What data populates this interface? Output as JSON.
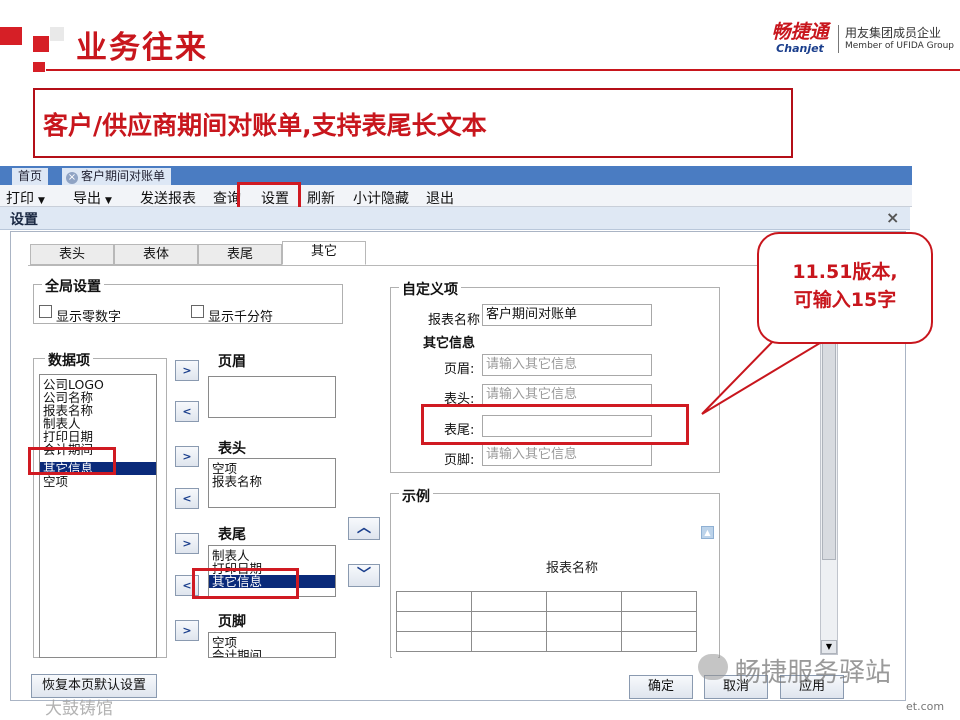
{
  "slide": {
    "title": "业务往来",
    "subtitle": "客户/供应商期间对账单,支持表尾长文本",
    "brand_name": "畅捷通",
    "brand_sub": "Chanjet",
    "brand_right1": "用友集团成员企业",
    "brand_right2": "Member of UFIDA Group",
    "accent_color": "#c8161d"
  },
  "app": {
    "tabs": [
      "首页",
      "客户期间对账单"
    ],
    "toolbar": [
      "打印",
      "导出",
      "发送报表",
      "查询",
      "设置",
      "刷新",
      "小计隐藏",
      "退出"
    ]
  },
  "dialog": {
    "title": "设置",
    "close": "×",
    "tabs": [
      "表头",
      "表体",
      "表尾",
      "其它"
    ],
    "global": {
      "legend": "全局设置",
      "show_zero": "显示零数字",
      "show_thousands": "显示千分符"
    },
    "data_items": {
      "legend": "数据项",
      "items": [
        "公司LOGO",
        "公司名称",
        "报表名称",
        "制表人",
        "打印日期",
        "会计期间",
        "其它信息",
        "空项"
      ],
      "selected": "其它信息"
    },
    "arrows": {
      "right": ">",
      "left": "<",
      "up": "︿",
      "down": "﹀"
    },
    "page_header": {
      "legend": "页眉",
      "items": []
    },
    "report_header": {
      "legend": "表头",
      "items": [
        "空项",
        "报表名称"
      ]
    },
    "report_footer": {
      "legend": "表尾",
      "items": [
        "制表人",
        "打印日期",
        "其它信息"
      ],
      "selected": "其它信息"
    },
    "page_footer": {
      "legend": "页脚",
      "items": [
        "空项",
        "会计期间"
      ]
    },
    "custom": {
      "legend": "自定义项",
      "report_name_label": "报表名称",
      "report_name_value": "客户期间对账单",
      "other_info_title": "其它信息",
      "page_header_label": "页眉:",
      "page_header_placeholder": "请输入其它信息",
      "table_header_label": "表头:",
      "table_header_placeholder": "请输入其它信息",
      "table_footer_label": "表尾:",
      "table_footer_value": "",
      "page_footer_label": "页脚:",
      "page_footer_placeholder": "请输入其它信息"
    },
    "preview": {
      "legend": "示例",
      "report_name": "报表名称"
    },
    "buttons": {
      "restore": "恢复本页默认设置",
      "ok": "确定",
      "cancel": "取消",
      "apply": "应用"
    }
  },
  "callout": {
    "line1": "11.51版本,",
    "line2": "可输入15字"
  },
  "watermark": {
    "wechat": "畅捷服务驿站",
    "left": "大鼓铸馆",
    "right": "et.com"
  }
}
